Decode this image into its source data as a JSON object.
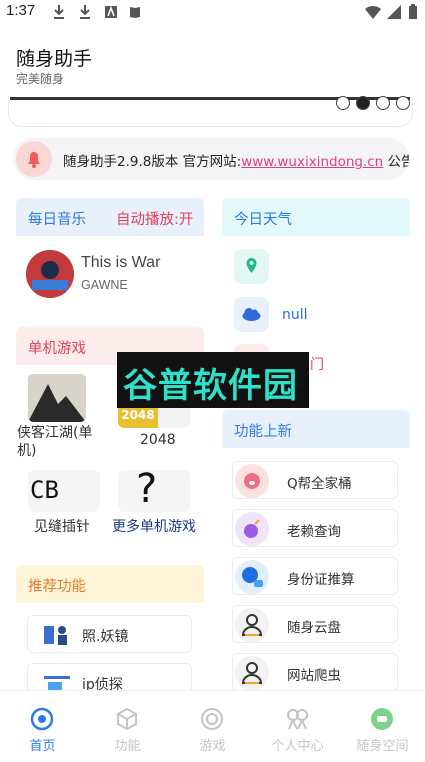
{
  "status_bar": {
    "time": "1:37"
  },
  "header": {
    "title": "随身助手",
    "subtitle": "完美随身"
  },
  "notice": {
    "prefix": "随身助手2.9.8版本  官方网站:",
    "link": "www.wuxixindong.cn",
    "suffix": " 公告"
  },
  "music": {
    "heading": "每日音乐",
    "autoplay": "自动播放:开",
    "track_title": "This is War",
    "artist": "GAWNE"
  },
  "weather": {
    "heading": "今日天气",
    "location_value": "",
    "condition": "null",
    "advice": "宜出门"
  },
  "games": {
    "heading": "单机游戏",
    "items": [
      {
        "label": "侠客江湖(单机)",
        "thumb": "江湖"
      },
      {
        "label": "2048",
        "thumb": "2048"
      },
      {
        "label": "见缝插针",
        "thumb": "CB"
      },
      {
        "label": "更多单机游戏",
        "thumb": "?"
      }
    ]
  },
  "features": {
    "heading": "功能上新",
    "items": [
      {
        "label": "Q帮全家桶",
        "icon": "pig-icon"
      },
      {
        "label": "老赖查询",
        "icon": "bomb-icon"
      },
      {
        "label": "身份证推算",
        "icon": "chat-gear-icon"
      },
      {
        "label": "随身云盘",
        "icon": "user-icon"
      },
      {
        "label": "网站爬虫",
        "icon": "user-icon"
      }
    ]
  },
  "recommend": {
    "heading": "推荐功能",
    "items": [
      {
        "label": "照.妖镜",
        "icon": "people-icon"
      },
      {
        "label": "ip侦探",
        "icon": "detective-icon"
      }
    ]
  },
  "watermark": {
    "text": "谷普软件园"
  },
  "nav": {
    "items": [
      {
        "label": "首页",
        "icon": "home-target-icon",
        "active": true
      },
      {
        "label": "功能",
        "icon": "cube-icon",
        "active": false
      },
      {
        "label": "游戏",
        "icon": "swirl-icon",
        "active": false
      },
      {
        "label": "个人中心",
        "icon": "person-icon",
        "active": false
      },
      {
        "label": "随身空间",
        "icon": "chat-bubble-icon",
        "active": false
      }
    ]
  },
  "colors": {
    "accent_blue": "#2f7ae5",
    "accent_red": "#e0405a",
    "accent_orange": "#e0802a",
    "link_pink": "#e0407b"
  }
}
